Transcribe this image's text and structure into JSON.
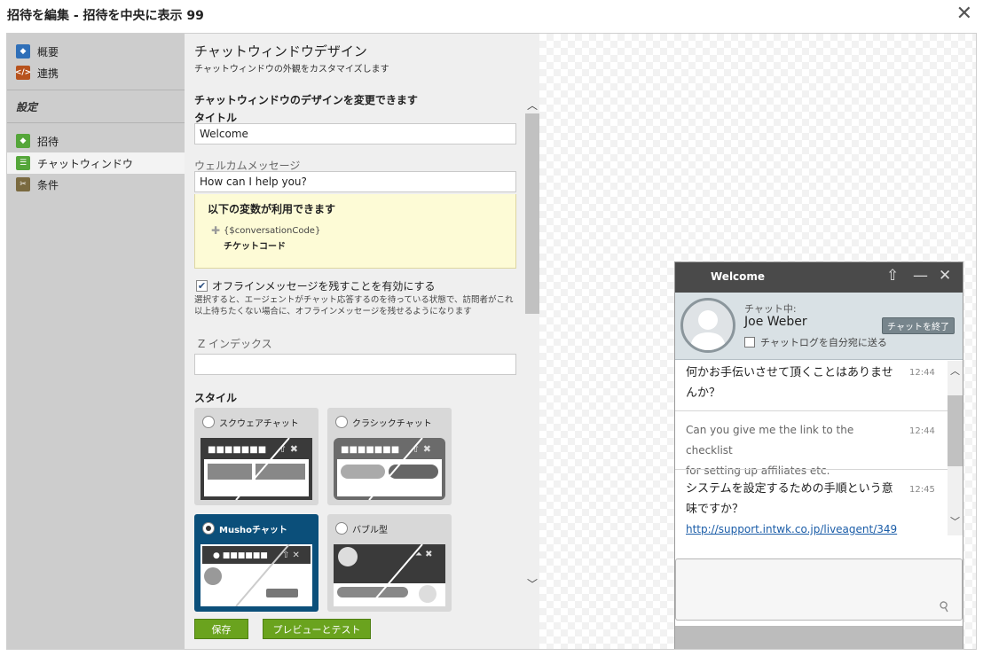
{
  "dialog": {
    "title": "招待を編集 - 招待を中央に表示 99",
    "close_icon": "close-icon"
  },
  "sidebar": {
    "top_items": [
      {
        "label": "概要",
        "icon": "overview-icon",
        "color": "#2f6fb8"
      },
      {
        "label": "連携",
        "icon": "code-icon",
        "color": "#b7521d"
      }
    ],
    "heading": "設定",
    "items": [
      {
        "label": "招待",
        "icon": "invitation-icon",
        "color": "#55a63a"
      },
      {
        "label": "チャットウィンドウ",
        "icon": "chat-window-icon",
        "color": "#55a63a",
        "active": true
      },
      {
        "label": "条件",
        "icon": "conditions-icon",
        "color": "#7a6a40"
      }
    ]
  },
  "form": {
    "heading": "チャットウィンドウデザイン",
    "subheading": "チャットウィンドウの外観をカスタマイズします",
    "section_title": "チャットウィンドウのデザインを変更できます",
    "title_label": "タイトル",
    "title_value": "Welcome",
    "welcome_label": "ウェルカムメッセージ",
    "welcome_value": "How can I help you?",
    "variables": {
      "heading": "以下の変数が利用できます",
      "code": "{$conversationCode}",
      "name": "チケットコード"
    },
    "offline_checkbox": {
      "label": "オフラインメッセージを残すことを有効にする",
      "checked": true
    },
    "offline_desc_1": "選択すると、エージェントがチャット応答するのを待っている状態で、訪問者がこれ",
    "offline_desc_2": "以上待ちたくない場合に、オフラインメッセージを残せるようになります",
    "zindex_label": "Z インデックス",
    "zindex_value": "",
    "style_label": "スタイル",
    "styles": [
      {
        "name": "スクウェアチャット",
        "selected": false
      },
      {
        "name": "クラシックチャット",
        "selected": false
      },
      {
        "name": "Mushoチャット",
        "selected": true
      },
      {
        "name": "バブル型",
        "selected": false
      }
    ],
    "save_button": "保存",
    "preview_button": "プレビューとテスト"
  },
  "chat_preview": {
    "title": "Welcome",
    "status": "チャット中:",
    "agent_name": "Joe Weber",
    "end_button": "チャットを終了",
    "send_log_label": "チャットログを自分宛に送る",
    "messages": [
      {
        "line1": "何かお手伝いさせて頂くことはありませ",
        "line2": "んか？",
        "time": "12:44",
        "from": "agent"
      },
      {
        "line1": "Can you give me the link to the checklist",
        "line2": "for setting up affiliates etc.",
        "time": "12:44",
        "from": "visitor"
      },
      {
        "line1": "システムを設定するための手順という意",
        "line2": "味ですか？",
        "time": "12:45",
        "from": "agent"
      }
    ],
    "link_text": "http://support.intwk.co.jp/liveagent/349"
  },
  "colors": {
    "accent_green": "#6aa31e",
    "selected_style": "#0b4f7a",
    "chat_header": "#4a4a4a"
  }
}
